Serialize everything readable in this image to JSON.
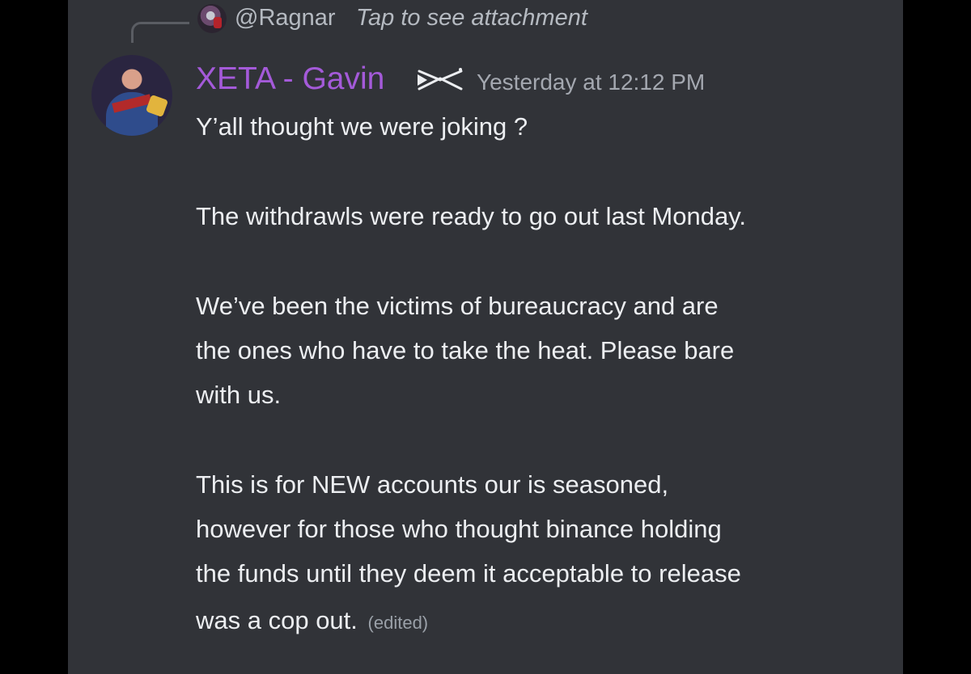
{
  "reply": {
    "username": "@Ragnar",
    "hint": "Tap to see attachment"
  },
  "message": {
    "author": "XETA - Gavin",
    "role_icon": "crossed-swords-icon",
    "timestamp": "Yesterday at 12:12 PM",
    "lines": [
      "Y’all thought we were joking ?",
      "The withdrawls were ready to go out last Monday.",
      "We’ve been the victims of bureaucracy and are",
      "the ones who have to take the heat. Please bare",
      "with us.",
      "This is for NEW accounts our is seasoned,",
      "however for those who thought binance holding",
      "the funds until they deem it acceptable to release",
      "was a cop out."
    ],
    "edited_label": "(edited)"
  },
  "colors": {
    "background": "#313338",
    "author": "#a45ad9",
    "text": "#eceef1",
    "muted": "#a4a8b0"
  }
}
